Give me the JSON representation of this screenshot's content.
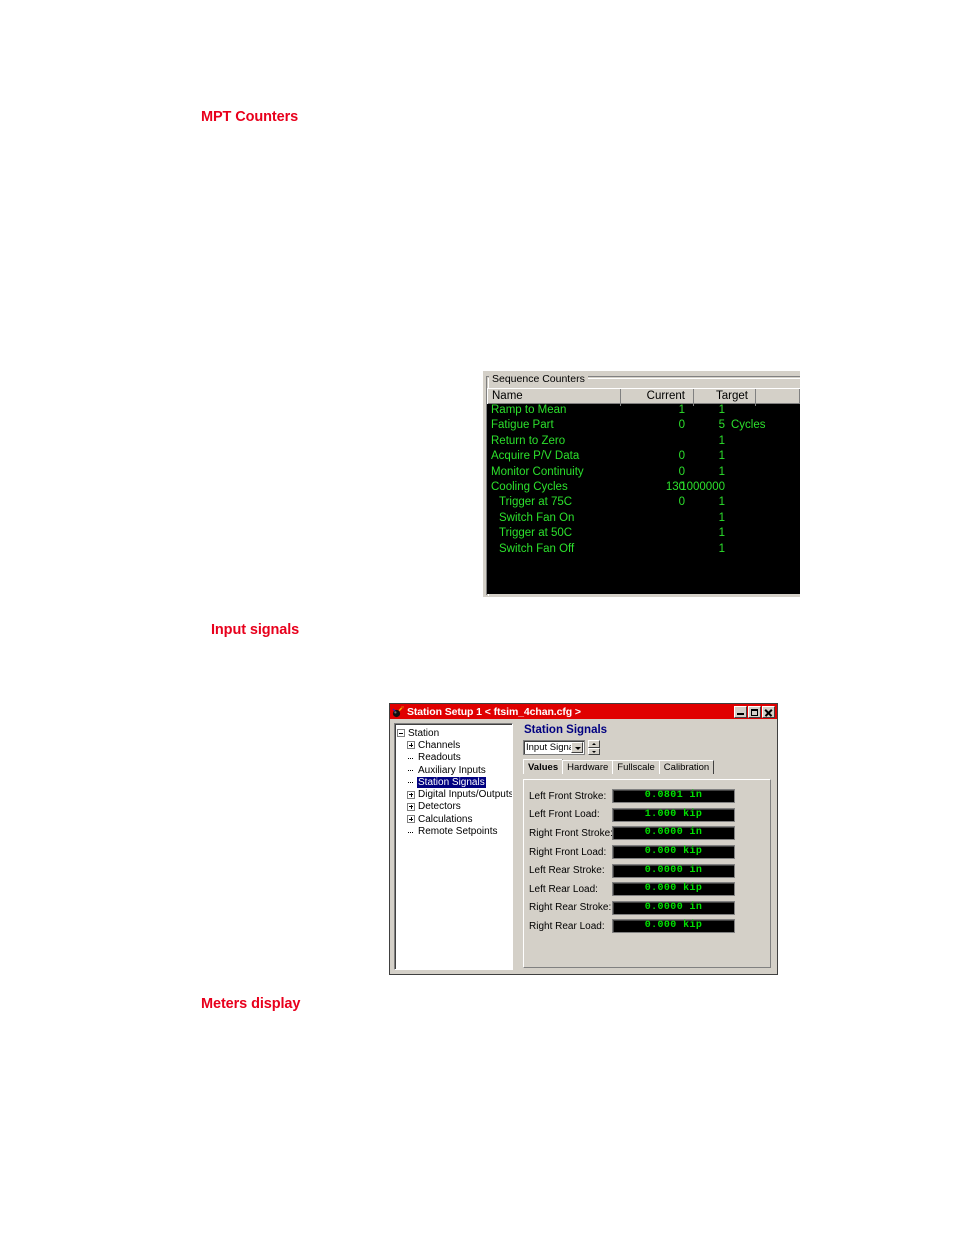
{
  "headings": {
    "mpt_counters": "MPT Counters",
    "input_signals": "Input signals",
    "meters_display": "Meters display"
  },
  "colors": {
    "heading_red": "#e8001c",
    "titlebar_red": "#e00000",
    "meter_green": "#00e000",
    "grid_green": "#2ce02c",
    "panel_face": "#d4d0c8",
    "selection_blue": "#000080"
  },
  "counters_panel": {
    "group_title": "Sequence Counters",
    "columns": [
      "Name",
      "Current",
      "Target",
      ""
    ],
    "rows": [
      {
        "name": "Ramp to Mean",
        "current": "1",
        "target": "1",
        "unit": "",
        "indent": false
      },
      {
        "name": "Fatigue Part",
        "current": "0",
        "target": "5",
        "unit": "Cycles",
        "indent": false
      },
      {
        "name": "Return to Zero",
        "current": "",
        "target": "1",
        "unit": "",
        "indent": false
      },
      {
        "name": "Acquire P/V Data",
        "current": "0",
        "target": "1",
        "unit": "",
        "indent": false
      },
      {
        "name": "Monitor Continuity",
        "current": "0",
        "target": "1",
        "unit": "",
        "indent": false
      },
      {
        "name": "Cooling Cycles",
        "current": "130",
        "target": "1000000",
        "unit": "",
        "indent": false
      },
      {
        "name": "Trigger at 75C",
        "current": "0",
        "target": "1",
        "unit": "",
        "indent": true
      },
      {
        "name": "Switch Fan On",
        "current": "",
        "target": "1",
        "unit": "",
        "indent": true
      },
      {
        "name": "Trigger at 50C",
        "current": "",
        "target": "1",
        "unit": "",
        "indent": true
      },
      {
        "name": "Switch Fan Off",
        "current": "",
        "target": "1",
        "unit": "",
        "indent": true
      }
    ]
  },
  "station_setup": {
    "title": "Station Setup 1 < ftsim_4chan.cfg >",
    "window_buttons": {
      "minimize": "minimize-button",
      "maximize": "maximize-button",
      "close": "close-button"
    },
    "tree": [
      {
        "label": "Station",
        "indent": 0,
        "toggle": "minus",
        "selected": false
      },
      {
        "label": "Channels",
        "indent": 1,
        "toggle": "plus",
        "selected": false
      },
      {
        "label": "Readouts",
        "indent": 1,
        "toggle": "leaf",
        "selected": false
      },
      {
        "label": "Auxiliary Inputs",
        "indent": 1,
        "toggle": "leaf",
        "selected": false
      },
      {
        "label": "Station Signals",
        "indent": 1,
        "toggle": "leaf",
        "selected": true
      },
      {
        "label": "Digital Inputs/Outputs",
        "indent": 1,
        "toggle": "plus",
        "selected": false
      },
      {
        "label": "Detectors",
        "indent": 1,
        "toggle": "plus",
        "selected": false
      },
      {
        "label": "Calculations",
        "indent": 1,
        "toggle": "plus",
        "selected": false
      },
      {
        "label": "Remote Setpoints",
        "indent": 1,
        "toggle": "leaf",
        "selected": false
      }
    ],
    "content_title": "Station Signals",
    "signal_selector": {
      "value": "Input Signals"
    },
    "tabs": [
      {
        "label": "Values",
        "active": true
      },
      {
        "label": "Hardware",
        "active": false
      },
      {
        "label": "Fullscale",
        "active": false
      },
      {
        "label": "Calibration",
        "active": false
      }
    ],
    "signals": [
      {
        "label": "Left Front Stroke:",
        "value": "0.0801 in"
      },
      {
        "label": "Left Front Load:",
        "value": "1.000 kip"
      },
      {
        "label": "Right Front Stroke:",
        "value": "0.0000 in"
      },
      {
        "label": "Right Front Load:",
        "value": "0.000 kip"
      },
      {
        "label": "Left Rear Stroke:",
        "value": "0.0000 in"
      },
      {
        "label": "Left Rear Load:",
        "value": "0.000 kip"
      },
      {
        "label": "Right Rear Stroke:",
        "value": "0.0000 in"
      },
      {
        "label": "Right Rear Load:",
        "value": "0.000 kip"
      }
    ]
  }
}
